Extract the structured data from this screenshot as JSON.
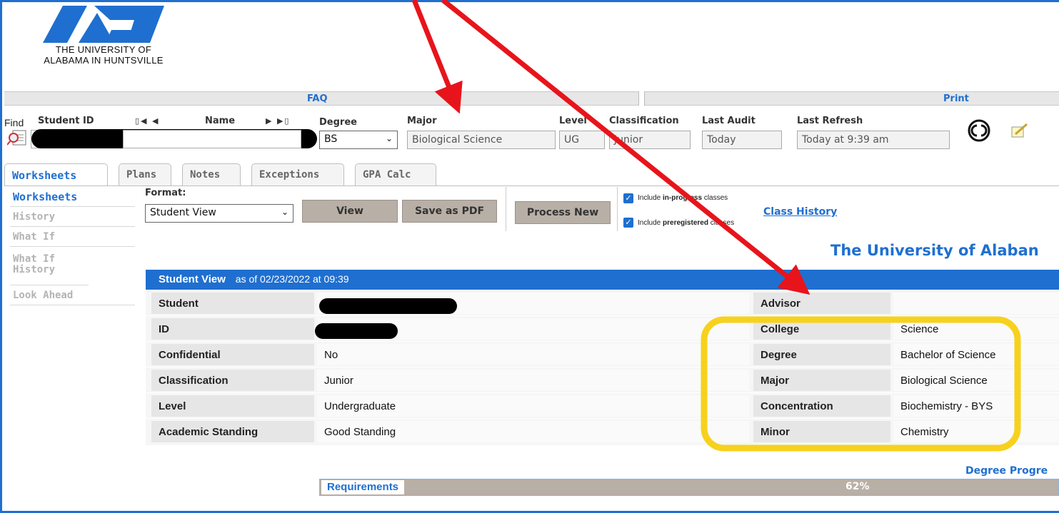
{
  "logo": {
    "line1": "THE UNIVERSITY OF",
    "line2": "ALABAMA IN HUNTSVILLE"
  },
  "linkbar": {
    "faq": "FAQ",
    "print": "Print"
  },
  "lookup": {
    "find_label": "Find",
    "student_id_label": "Student ID",
    "name_label": "Name",
    "degree_label": "Degree",
    "degree_value": "BS",
    "major_label": "Major",
    "major_value": "Biological Science",
    "level_label": "Level",
    "level_value": "UG",
    "classification_label": "Classification",
    "classification_value": "Junior",
    "last_audit_label": "Last Audit",
    "last_audit_value": "Today",
    "last_refresh_label": "Last Refresh",
    "last_refresh_value": "Today at 9:39 am"
  },
  "tabs": [
    "Worksheets",
    "Plans",
    "Notes",
    "Exceptions",
    "GPA Calc"
  ],
  "sidebar": [
    "Worksheets",
    "History",
    "What If",
    "What If History",
    "Look Ahead"
  ],
  "toolbar": {
    "format_label": "Format:",
    "format_value": "Student View",
    "view": "View",
    "save_pdf": "Save as PDF",
    "process_new": "Process New",
    "include_inprogress_prefix": "Include ",
    "include_inprogress_bold": "in-progress",
    "include_inprogress_suffix": " classes",
    "include_prereg_prefix": "Include ",
    "include_prereg_bold": "preregistered",
    "include_prereg_suffix": " classes",
    "class_history": "Class History"
  },
  "university_title": "The University of Alaban",
  "student_view": {
    "title": "Student View",
    "as_of": "as of 02/23/2022 at 09:39",
    "rows": [
      {
        "label": "Student",
        "value": "",
        "rlabel": "Advisor",
        "rvalue": ""
      },
      {
        "label": "ID",
        "value": "",
        "rlabel": "College",
        "rvalue": "Science"
      },
      {
        "label": "Confidential",
        "value": "No",
        "rlabel": "Degree",
        "rvalue": "Bachelor of Science"
      },
      {
        "label": "Classification",
        "value": "Junior",
        "rlabel": "Major",
        "rvalue": "Biological Science"
      },
      {
        "label": "Level",
        "value": "Undergraduate",
        "rlabel": "Concentration",
        "rvalue": "Biochemistry - BYS"
      },
      {
        "label": "Academic Standing",
        "value": "Good Standing",
        "rlabel": "Minor",
        "rvalue": "Chemistry"
      }
    ]
  },
  "requirements": {
    "degree_progress": "Degree Progre",
    "label": "Requirements",
    "percent": "62%",
    "progress_fraction": 0.62
  },
  "colors": {
    "accent": "#1f6fd0",
    "button": "#b8afa6",
    "annotation_arrow": "#e8141b",
    "annotation_highlight": "#f7d11e"
  }
}
